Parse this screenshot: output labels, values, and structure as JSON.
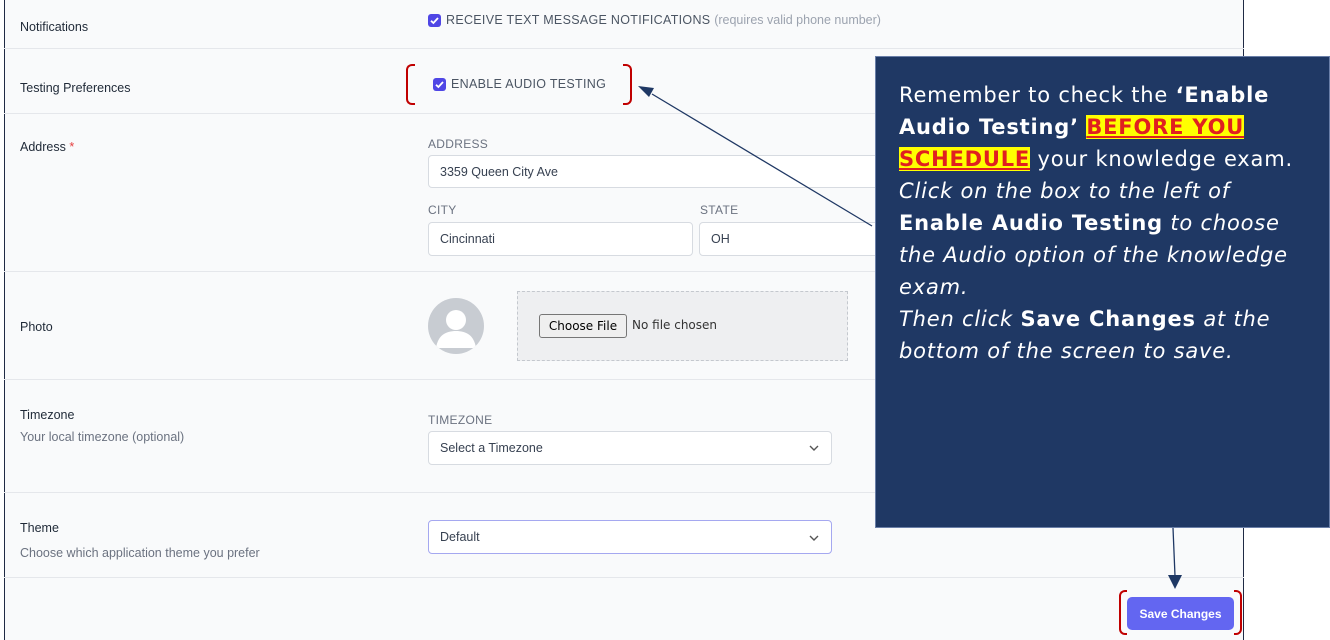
{
  "notifications": {
    "label": "Notifications",
    "checkbox_label": "RECEIVE TEXT MESSAGE NOTIFICATIONS",
    "checkbox_note": "(requires valid phone number)",
    "checked": true
  },
  "testing": {
    "label": "Testing Preferences",
    "checkbox_label": "ENABLE AUDIO TESTING",
    "checked": true
  },
  "address": {
    "label": "Address",
    "required_mark": "*",
    "address_caption": "ADDRESS",
    "address_value": "3359 Queen City Ave",
    "city_caption": "CITY",
    "city_value": "Cincinnati",
    "state_caption": "STATE",
    "state_value": "OH"
  },
  "photo": {
    "label": "Photo",
    "choose_file": "Choose File",
    "no_file": "No file chosen"
  },
  "timezone": {
    "label": "Timezone",
    "sublabel": "Your local timezone (optional)",
    "caption": "TIMEZONE",
    "placeholder": "Select a Timezone"
  },
  "theme": {
    "label": "Theme",
    "sublabel": "Choose which application theme you prefer",
    "value": "Default"
  },
  "save_button": "Save Changes",
  "callout": {
    "p1_a": "Remember to check the ",
    "p1_b": "‘Enable Audio Testing’",
    "p1_sp": " ",
    "p1_hl": "BEFORE YOU SCHEDULE",
    "p1_c": " your knowledge exam.",
    "p2_a": "Click on the box to the left of ",
    "p2_b": "Enable Audio Testing",
    "p2_c": " to choose the Audio option of the knowledge exam.",
    "p3_a": "Then click ",
    "p3_b": "Save Changes",
    "p3_c": " at the bottom of the screen to save."
  },
  "colors": {
    "accent": "#6366f1",
    "callout_bg": "#1f3864",
    "bracket": "#c00000",
    "highlight": "#ffff00"
  }
}
